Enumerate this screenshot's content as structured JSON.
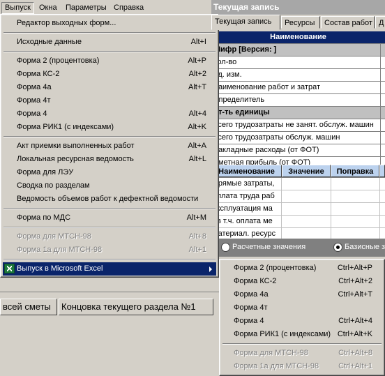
{
  "menubar": {
    "items": [
      "Выпуск",
      "Окна",
      "Параметры",
      "Справка"
    ]
  },
  "record_window": {
    "title": "Текущая запись",
    "tabs": [
      "Текущая запись",
      "Ресурсы",
      "Состав работ",
      "Д"
    ],
    "grid1": {
      "header": "Наименование",
      "rows": [
        {
          "text": "Шифр  [Версия: ]",
          "type": "sec"
        },
        {
          "text": "Кол-во",
          "type": "row"
        },
        {
          "text": "Ед. изм.",
          "type": "row"
        },
        {
          "text": "Наименование работ и затрат",
          "type": "row"
        },
        {
          "text": "Определитель",
          "type": "row"
        },
        {
          "text": "Ст-ть единицы",
          "type": "sec"
        },
        {
          "text": "Всего трудозатраты не занят. обслуж. машин",
          "type": "row"
        },
        {
          "text": "Всего трудозатраты обслуж. машин",
          "type": "row"
        },
        {
          "text": "Накладные расходы (от ФОТ)",
          "type": "row"
        },
        {
          "text": "Сметная прибыль (от ФОТ)",
          "type": "row"
        }
      ]
    },
    "grid2": {
      "columns": [
        "Наименование",
        "Значение",
        "Поправка",
        ""
      ],
      "rows": [
        "Прямые затраты,",
        "оплата труда раб",
        "эксплуатация ма",
        "в т.ч. оплата ме",
        "материал. ресурс"
      ]
    },
    "radios": [
      {
        "label": "Расчетные значения",
        "checked": false
      },
      {
        "label": "Базисные з",
        "checked": true
      }
    ]
  },
  "bottom_tabs": [
    "всей сметы",
    "Концовка текущего раздела №1"
  ],
  "main_menu": {
    "items": [
      {
        "label": "Редактор выходных форм...",
        "shortcut": "",
        "disabled": false
      },
      {
        "sep": true
      },
      {
        "label": "Исходные данные",
        "shortcut": "Alt+I",
        "disabled": false
      },
      {
        "sep": true
      },
      {
        "label": "Форма 2 (процентовка)",
        "shortcut": "Alt+P",
        "disabled": false
      },
      {
        "label": "Форма КС-2",
        "shortcut": "Alt+2",
        "disabled": false
      },
      {
        "label": "Форма 4а",
        "shortcut": "Alt+T",
        "disabled": false
      },
      {
        "label": "Форма 4т",
        "shortcut": "",
        "disabled": false
      },
      {
        "label": "Форма 4",
        "shortcut": "Alt+4",
        "disabled": false
      },
      {
        "label": "Форма РИК1 (с индексами)",
        "shortcut": "Alt+K",
        "disabled": false
      },
      {
        "sep": true
      },
      {
        "label": "Акт приемки выполненных работ",
        "shortcut": "Alt+A",
        "disabled": false
      },
      {
        "label": "Локальная ресурсная ведомость",
        "shortcut": "Alt+L",
        "disabled": false
      },
      {
        "label": "Форма для ЛЭУ",
        "shortcut": "",
        "disabled": false
      },
      {
        "label": "Сводка по разделам",
        "shortcut": "",
        "disabled": false
      },
      {
        "label": "Ведомость объемов работ к дефектной ведомости",
        "shortcut": "",
        "disabled": false
      },
      {
        "sep": true
      },
      {
        "label": "Форма по МДС",
        "shortcut": "Alt+M",
        "disabled": false
      },
      {
        "sep": true
      },
      {
        "label": "Форма для МТСН-98",
        "shortcut": "Alt+8",
        "disabled": true
      },
      {
        "label": "Форма 1а для МТСН-98",
        "shortcut": "Alt+1",
        "disabled": true
      },
      {
        "sep": true
      },
      {
        "label": "Выпуск в Microsoft Excel",
        "shortcut": "",
        "disabled": false,
        "selected": true,
        "submenu": true,
        "icon": "excel-icon"
      }
    ]
  },
  "sub_menu": {
    "items": [
      {
        "label": "Форма 2 (процентовка)",
        "shortcut": "Ctrl+Alt+P",
        "disabled": false
      },
      {
        "label": "Форма КС-2",
        "shortcut": "Ctrl+Alt+2",
        "disabled": false
      },
      {
        "label": "Форма 4а",
        "shortcut": "Ctrl+Alt+T",
        "disabled": false
      },
      {
        "label": "Форма 4т",
        "shortcut": "",
        "disabled": false
      },
      {
        "label": "Форма 4",
        "shortcut": "Ctrl+Alt+4",
        "disabled": false
      },
      {
        "label": "Форма РИК1 (с индексами)",
        "shortcut": "Ctrl+Alt+K",
        "disabled": false
      },
      {
        "sep": true
      },
      {
        "label": "Форма для МТСН-98",
        "shortcut": "Ctrl+Alt+8",
        "disabled": true
      },
      {
        "label": "Форма 1а для МТСН-98",
        "shortcut": "Ctrl+Alt+1",
        "disabled": true
      }
    ]
  }
}
